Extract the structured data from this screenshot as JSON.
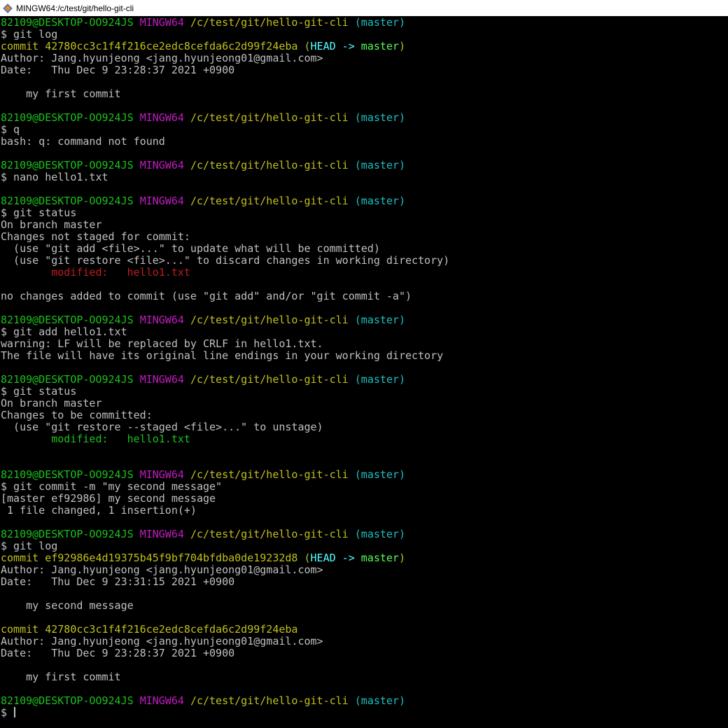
{
  "window": {
    "title": "MINGW64:/c/test/git/hello-git-cli"
  },
  "colors": {
    "background": "#000000",
    "text": "#c0c0c0",
    "green": "#1cc01c",
    "magenta": "#c01cc0",
    "yellow": "#c0c01c",
    "cyan": "#1cc0c0",
    "red": "#c01c1c",
    "bright_cyan": "#55ffff",
    "bright_green": "#55ff55"
  },
  "terminal": {
    "lines": [
      [
        [
          "82109@DESKTOP-OO924JS",
          "green"
        ],
        [
          " ",
          "default"
        ],
        [
          "MINGW64",
          "magenta"
        ],
        [
          " ",
          "default"
        ],
        [
          "/c/test/git/hello-git-cli",
          "yellow"
        ],
        [
          " ",
          "default"
        ],
        [
          "(master)",
          "cyan"
        ]
      ],
      [
        [
          "$ git log",
          "default"
        ]
      ],
      [
        [
          "commit 42780cc3c1f4f216ce2edc8cefda6c2d99f24eba (",
          "yellow"
        ],
        [
          "HEAD -> ",
          "brcyan"
        ],
        [
          "master",
          "brgreen"
        ],
        [
          ")",
          "yellow"
        ]
      ],
      [
        [
          "Author: Jang.hyunjeong <jang.hyunjeong01@gmail.com>",
          "default"
        ]
      ],
      [
        [
          "Date:   Thu Dec 9 23:28:37 2021 +0900",
          "default"
        ]
      ],
      [
        [
          "",
          "default"
        ]
      ],
      [
        [
          "    my first commit",
          "default"
        ]
      ],
      [
        [
          "",
          "default"
        ]
      ],
      [
        [
          "82109@DESKTOP-OO924JS",
          "green"
        ],
        [
          " ",
          "default"
        ],
        [
          "MINGW64",
          "magenta"
        ],
        [
          " ",
          "default"
        ],
        [
          "/c/test/git/hello-git-cli",
          "yellow"
        ],
        [
          " ",
          "default"
        ],
        [
          "(master)",
          "cyan"
        ]
      ],
      [
        [
          "$ q",
          "default"
        ]
      ],
      [
        [
          "bash: q: command not found",
          "default"
        ]
      ],
      [
        [
          "",
          "default"
        ]
      ],
      [
        [
          "82109@DESKTOP-OO924JS",
          "green"
        ],
        [
          " ",
          "default"
        ],
        [
          "MINGW64",
          "magenta"
        ],
        [
          " ",
          "default"
        ],
        [
          "/c/test/git/hello-git-cli",
          "yellow"
        ],
        [
          " ",
          "default"
        ],
        [
          "(master)",
          "cyan"
        ]
      ],
      [
        [
          "$ nano hello1.txt",
          "default"
        ]
      ],
      [
        [
          "",
          "default"
        ]
      ],
      [
        [
          "82109@DESKTOP-OO924JS",
          "green"
        ],
        [
          " ",
          "default"
        ],
        [
          "MINGW64",
          "magenta"
        ],
        [
          " ",
          "default"
        ],
        [
          "/c/test/git/hello-git-cli",
          "yellow"
        ],
        [
          " ",
          "default"
        ],
        [
          "(master)",
          "cyan"
        ]
      ],
      [
        [
          "$ git status",
          "default"
        ]
      ],
      [
        [
          "On branch master",
          "default"
        ]
      ],
      [
        [
          "Changes not staged for commit:",
          "default"
        ]
      ],
      [
        [
          "  (use \"git add <file>...\" to update what will be committed)",
          "default"
        ]
      ],
      [
        [
          "  (use \"git restore <file>...\" to discard changes in working directory)",
          "default"
        ]
      ],
      [
        [
          "        ",
          "default"
        ],
        [
          "modified:   hello1.txt",
          "red"
        ]
      ],
      [
        [
          "",
          "default"
        ]
      ],
      [
        [
          "no changes added to commit (use \"git add\" and/or \"git commit -a\")",
          "default"
        ]
      ],
      [
        [
          "",
          "default"
        ]
      ],
      [
        [
          "82109@DESKTOP-OO924JS",
          "green"
        ],
        [
          " ",
          "default"
        ],
        [
          "MINGW64",
          "magenta"
        ],
        [
          " ",
          "default"
        ],
        [
          "/c/test/git/hello-git-cli",
          "yellow"
        ],
        [
          " ",
          "default"
        ],
        [
          "(master)",
          "cyan"
        ]
      ],
      [
        [
          "$ git add hello1.txt",
          "default"
        ]
      ],
      [
        [
          "warning: LF will be replaced by CRLF in hello1.txt.",
          "default"
        ]
      ],
      [
        [
          "The file will have its original line endings in your working directory",
          "default"
        ]
      ],
      [
        [
          "",
          "default"
        ]
      ],
      [
        [
          "82109@DESKTOP-OO924JS",
          "green"
        ],
        [
          " ",
          "default"
        ],
        [
          "MINGW64",
          "magenta"
        ],
        [
          " ",
          "default"
        ],
        [
          "/c/test/git/hello-git-cli",
          "yellow"
        ],
        [
          " ",
          "default"
        ],
        [
          "(master)",
          "cyan"
        ]
      ],
      [
        [
          "$ git status",
          "default"
        ]
      ],
      [
        [
          "On branch master",
          "default"
        ]
      ],
      [
        [
          "Changes to be committed:",
          "default"
        ]
      ],
      [
        [
          "  (use \"git restore --staged <file>...\" to unstage)",
          "default"
        ]
      ],
      [
        [
          "        ",
          "default"
        ],
        [
          "modified:   hello1.txt",
          "green"
        ]
      ],
      [
        [
          "",
          "default"
        ]
      ],
      [
        [
          "",
          "default"
        ]
      ],
      [
        [
          "82109@DESKTOP-OO924JS",
          "green"
        ],
        [
          " ",
          "default"
        ],
        [
          "MINGW64",
          "magenta"
        ],
        [
          " ",
          "default"
        ],
        [
          "/c/test/git/hello-git-cli",
          "yellow"
        ],
        [
          " ",
          "default"
        ],
        [
          "(master)",
          "cyan"
        ]
      ],
      [
        [
          "$ git commit -m \"my second message\"",
          "default"
        ]
      ],
      [
        [
          "[master ef92986] my second message",
          "default"
        ]
      ],
      [
        [
          " 1 file changed, 1 insertion(+)",
          "default"
        ]
      ],
      [
        [
          "",
          "default"
        ]
      ],
      [
        [
          "82109@DESKTOP-OO924JS",
          "green"
        ],
        [
          " ",
          "default"
        ],
        [
          "MINGW64",
          "magenta"
        ],
        [
          " ",
          "default"
        ],
        [
          "/c/test/git/hello-git-cli",
          "yellow"
        ],
        [
          " ",
          "default"
        ],
        [
          "(master)",
          "cyan"
        ]
      ],
      [
        [
          "$ git log",
          "default"
        ]
      ],
      [
        [
          "commit ef92986e4d19375b45f9bf704bfdba0de19232d8 (",
          "yellow"
        ],
        [
          "HEAD -> ",
          "brcyan"
        ],
        [
          "master",
          "brgreen"
        ],
        [
          ")",
          "yellow"
        ]
      ],
      [
        [
          "Author: Jang.hyunjeong <jang.hyunjeong01@gmail.com>",
          "default"
        ]
      ],
      [
        [
          "Date:   Thu Dec 9 23:31:15 2021 +0900",
          "default"
        ]
      ],
      [
        [
          "",
          "default"
        ]
      ],
      [
        [
          "    my second message",
          "default"
        ]
      ],
      [
        [
          "",
          "default"
        ]
      ],
      [
        [
          "commit 42780cc3c1f4f216ce2edc8cefda6c2d99f24eba",
          "yellow"
        ]
      ],
      [
        [
          "Author: Jang.hyunjeong <jang.hyunjeong01@gmail.com>",
          "default"
        ]
      ],
      [
        [
          "Date:   Thu Dec 9 23:28:37 2021 +0900",
          "default"
        ]
      ],
      [
        [
          "",
          "default"
        ]
      ],
      [
        [
          "    my first commit",
          "default"
        ]
      ],
      [
        [
          "",
          "default"
        ]
      ],
      [
        [
          "82109@DESKTOP-OO924JS",
          "green"
        ],
        [
          " ",
          "default"
        ],
        [
          "MINGW64",
          "magenta"
        ],
        [
          " ",
          "default"
        ],
        [
          "/c/test/git/hello-git-cli",
          "yellow"
        ],
        [
          " ",
          "default"
        ],
        [
          "(master)",
          "cyan"
        ]
      ],
      [
        [
          "$ ",
          "default"
        ]
      ]
    ]
  }
}
